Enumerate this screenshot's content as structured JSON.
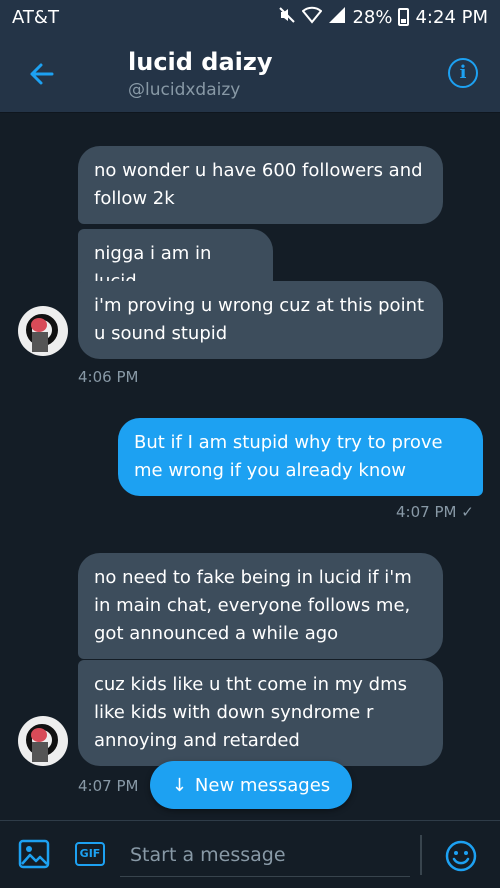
{
  "status_bar": {
    "carrier": "AT&T",
    "battery": "28%",
    "time": "4:24 PM"
  },
  "header": {
    "name": "lucid daizy",
    "handle": "@lucidxdaizy",
    "info_glyph": "i"
  },
  "messages": [
    {
      "side": "in",
      "text": "no wonder u have 600 followers and follow 2k"
    },
    {
      "side": "in",
      "text": "nigga i am in lucid"
    },
    {
      "side": "in",
      "text": "i'm proving u wrong cuz at this point u sound stupid"
    },
    {
      "side": "out",
      "text": "But if I am stupid why try to prove me wrong if you already know"
    },
    {
      "side": "in",
      "text": "no need to fake being in lucid if i'm in main chat, everyone follows me, got announced a while ago"
    },
    {
      "side": "in",
      "text": "cuz kids like u tht come in my dms like kids with down syndrome r annoying and retarded"
    }
  ],
  "timestamps": {
    "first_group": "4:06 PM",
    "outgoing": "4:07 PM",
    "outgoing_check": "✓",
    "second_group": "4:07 PM"
  },
  "new_messages_label": "New messages",
  "new_messages_arrow": "↓",
  "composer": {
    "placeholder": "Start a message",
    "gif_label": "GIF"
  },
  "colors": {
    "accent": "#1da1f2",
    "background": "#141d26",
    "header": "#243447",
    "incoming_bubble": "#3d4d5c",
    "muted_text": "#8899a6"
  },
  "icons": [
    "back-arrow-icon",
    "info-icon",
    "image-icon",
    "gif-icon",
    "emoji-icon",
    "mute-icon",
    "wifi-icon",
    "signal-icon",
    "battery-icon",
    "check-icon",
    "down-arrow-icon"
  ]
}
